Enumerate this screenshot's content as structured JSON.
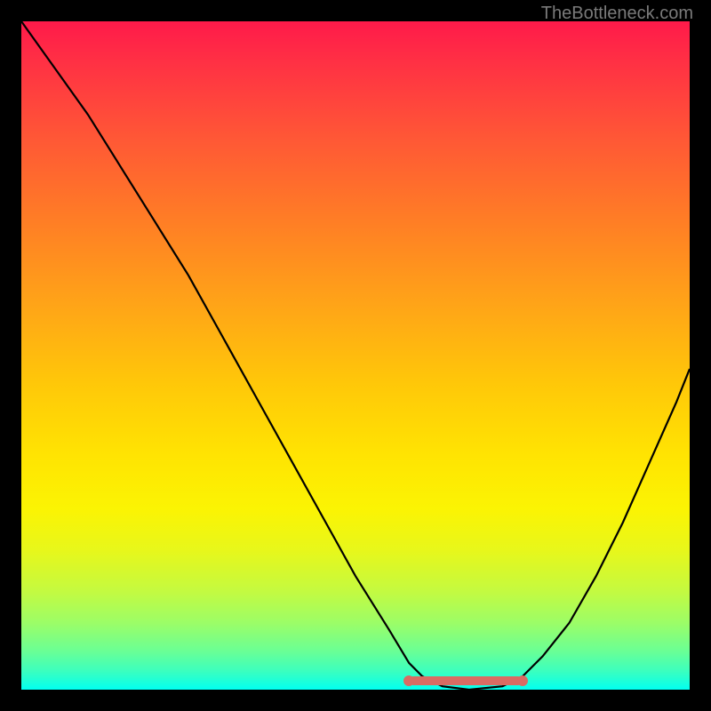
{
  "watermark": "TheBottleneck.com",
  "chart_data": {
    "type": "line",
    "title": "",
    "xlabel": "",
    "ylabel": "",
    "x_range": [
      0,
      100
    ],
    "y_range": [
      0,
      100
    ],
    "series": [
      {
        "name": "curve",
        "x": [
          0,
          5,
          10,
          15,
          20,
          25,
          30,
          35,
          40,
          45,
          50,
          55,
          58,
          60,
          63,
          67,
          72,
          75,
          78,
          82,
          86,
          90,
          94,
          98,
          100
        ],
        "y": [
          100,
          93,
          86,
          78,
          70,
          62,
          53,
          44,
          35,
          26,
          17,
          9,
          4,
          2,
          0.5,
          0,
          0.5,
          2,
          5,
          10,
          17,
          25,
          34,
          43,
          48
        ]
      }
    ],
    "trough": {
      "x_start": 58,
      "x_end": 75,
      "y": 0
    },
    "gradient_colors": {
      "top": "#ff1a4a",
      "mid": "#ffe402",
      "bottom": "#00fff2"
    }
  }
}
